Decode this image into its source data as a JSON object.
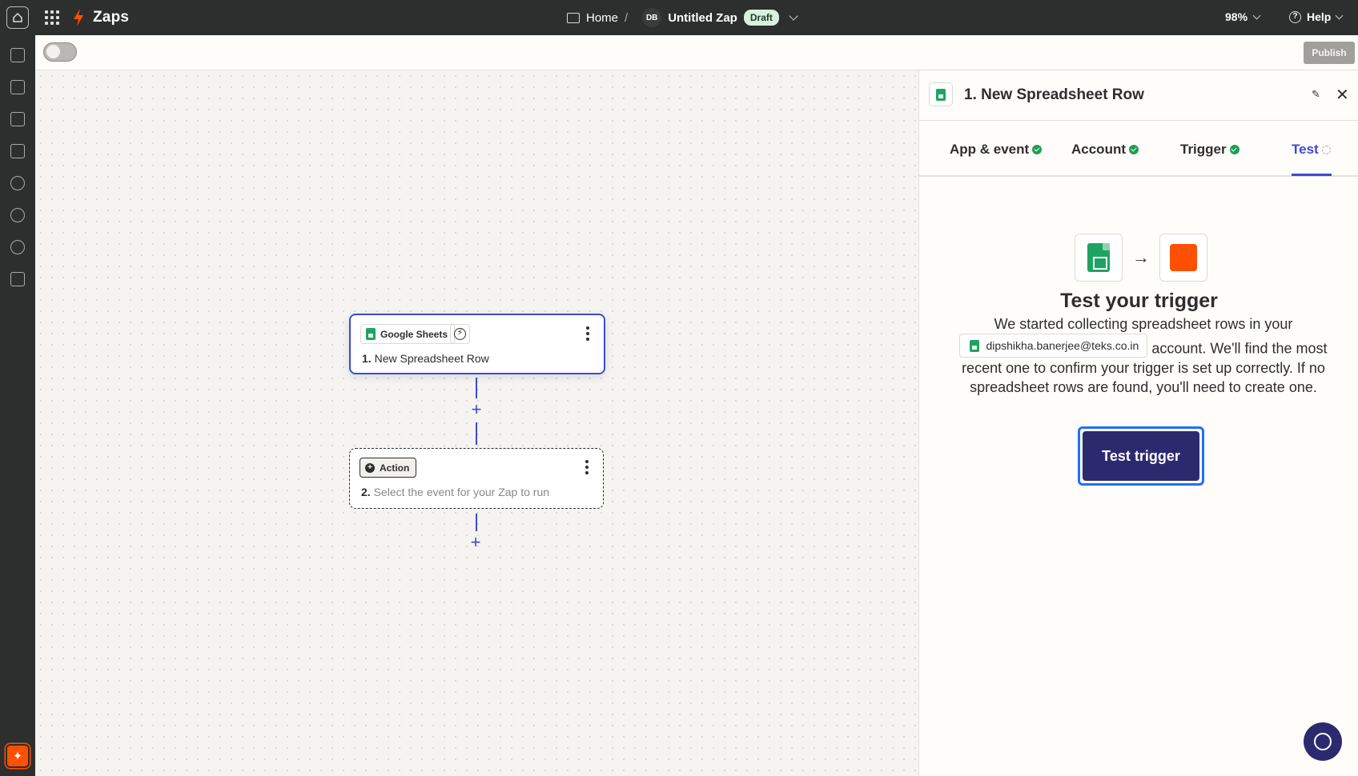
{
  "topbar": {
    "brand": "Zaps",
    "breadcrumb_home": "Home",
    "breadcrumb_sep": "/",
    "avatar_initials": "DB",
    "zap_name": "Untitled Zap",
    "status_badge": "Draft",
    "zoom": "98%",
    "help_label": "Help"
  },
  "toolbar": {
    "publish_label": "Publish",
    "zap_enabled": false
  },
  "canvas": {
    "step1": {
      "app_name": "Google Sheets",
      "number": "1.",
      "title": "New Spreadsheet Row"
    },
    "step2": {
      "chip_label": "Action",
      "number": "2.",
      "title": "Select the event for your Zap to run"
    },
    "plus_glyph": "+"
  },
  "panel": {
    "title": "1. New Spreadsheet Row",
    "tabs": [
      {
        "label": "App & event",
        "status": "complete"
      },
      {
        "label": "Account",
        "status": "complete"
      },
      {
        "label": "Trigger",
        "status": "complete"
      },
      {
        "label": "Test",
        "status": "pending"
      }
    ],
    "active_tab": "Test",
    "test_heading": "Test your trigger",
    "test_text_1": "We started collecting spreadsheet rows in your",
    "account_email": "dipshikha.banerjee@teks.co.in",
    "test_text_2": "account. We'll find the most recent one to confirm your trigger is set up correctly. If no spreadsheet rows are found, you'll need to create one.",
    "test_button_label": "Test trigger"
  },
  "colors": {
    "accent": "#3d4ad0",
    "brand_orange": "#ff4f00",
    "sheets_green": "#1ea362",
    "success_green": "#1f9d55",
    "primary_button": "#2c2a6f",
    "topbar_bg": "#2d2e2e"
  },
  "icons": {
    "home": "home-icon",
    "apps": "app-grid-icon",
    "bolt": "bolt-icon",
    "folder": "folder-icon",
    "help": "help-circle-icon",
    "edit": "pencil-icon",
    "close": "close-icon",
    "arrow": "arrow-right-icon",
    "support": "support-chat-icon"
  }
}
